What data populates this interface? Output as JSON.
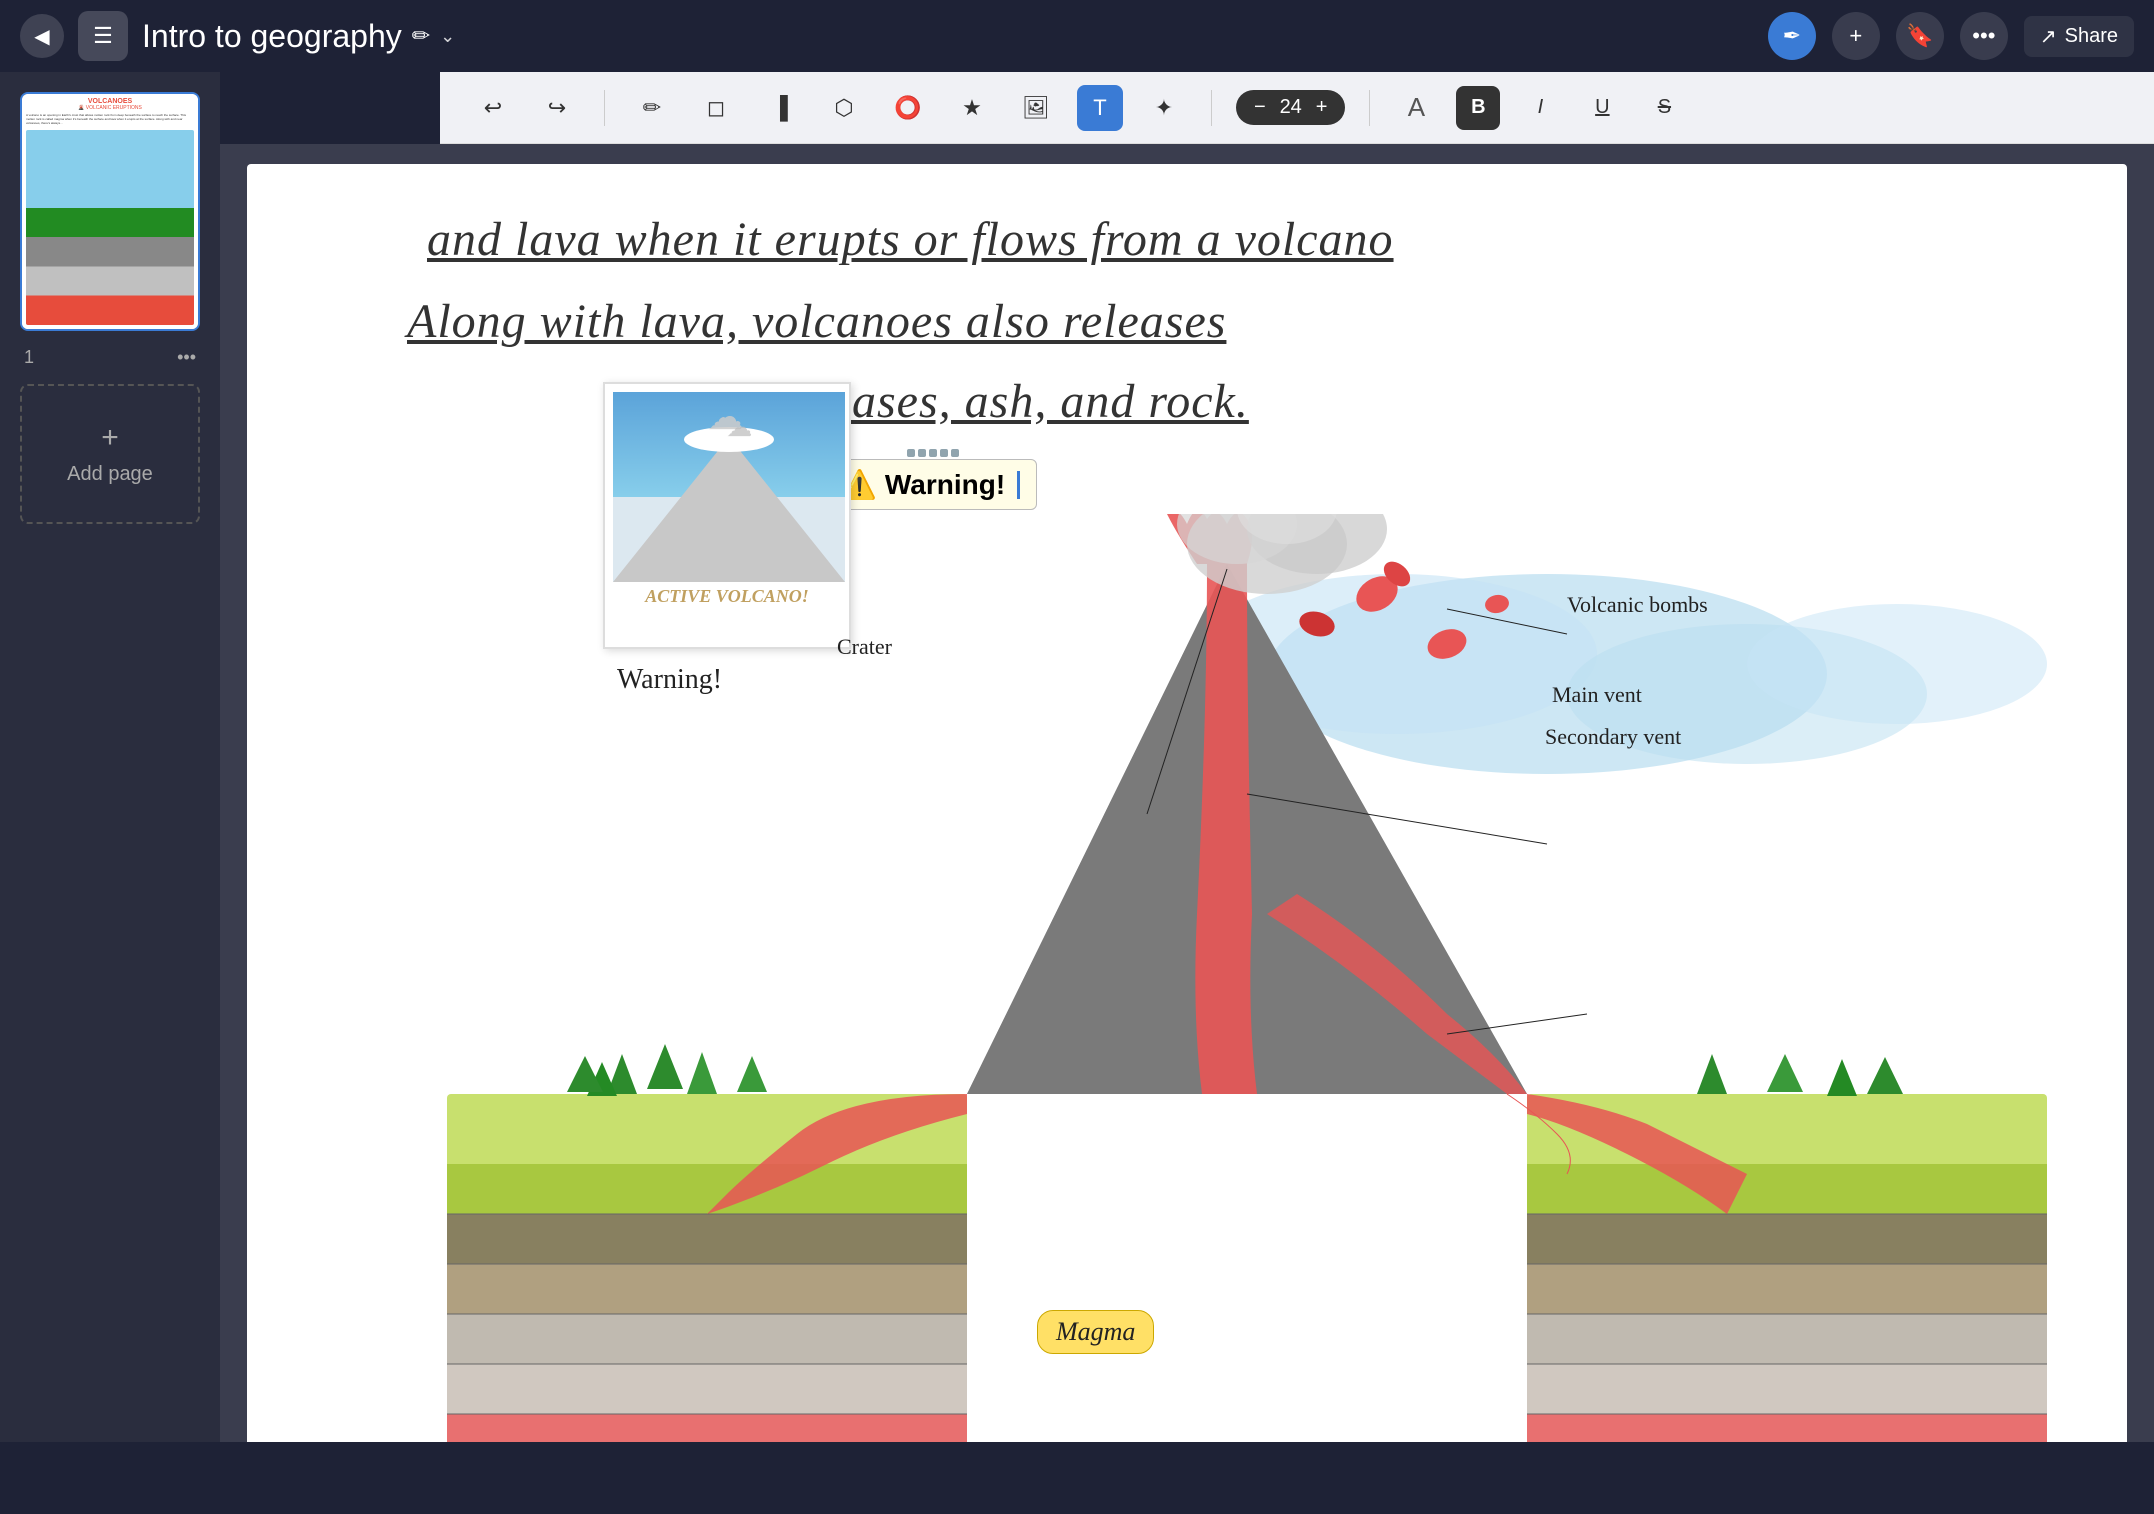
{
  "header": {
    "back_icon": "◀",
    "notebook_icon": "☰",
    "title": "Intro to geography",
    "title_pencil": "✏",
    "title_chevron": "⌄",
    "pen_icon": "✒",
    "add_icon": "+",
    "bookmark_icon": "🔖",
    "more_icon": "•••",
    "share_icon": "↗",
    "share_label": "Share"
  },
  "toolbar": {
    "undo_icon": "↩",
    "redo_icon": "↪",
    "pen_tool": "✏",
    "eraser_tool": "◻",
    "highlighter_tool": "▐",
    "lasso_tool": "⬡",
    "select_tool": "⭕",
    "star_tool": "★",
    "image_tool": "🖼",
    "text_tool": "T",
    "magic_tool": "✦",
    "font_size_minus": "−",
    "font_size_value": "24",
    "font_size_plus": "+",
    "font_icon": "A",
    "bold_label": "B",
    "italic_label": "I",
    "underline_label": "U",
    "strikethrough_label": "S"
  },
  "sidebar": {
    "page_number": "1",
    "more_icon": "•••",
    "add_page_label": "Add page",
    "add_plus": "+"
  },
  "canvas": {
    "line1": "and lava  when it erupts or flows from a volcano",
    "line2": "Along with lava, volcanoes also releases",
    "line3": "gases, ash, and rock.",
    "warning_emoji": "⚠️",
    "warning_text": "Warning!",
    "polaroid_caption": "ACTIVE VOLCANO!",
    "warning_label": "Warning!",
    "label_volcanic_bombs": "Volcanic bombs",
    "label_crater": "Crater",
    "label_main_vent": "Main vent",
    "label_secondary_vent": "Secondary vent",
    "label_magma": "Magma"
  }
}
